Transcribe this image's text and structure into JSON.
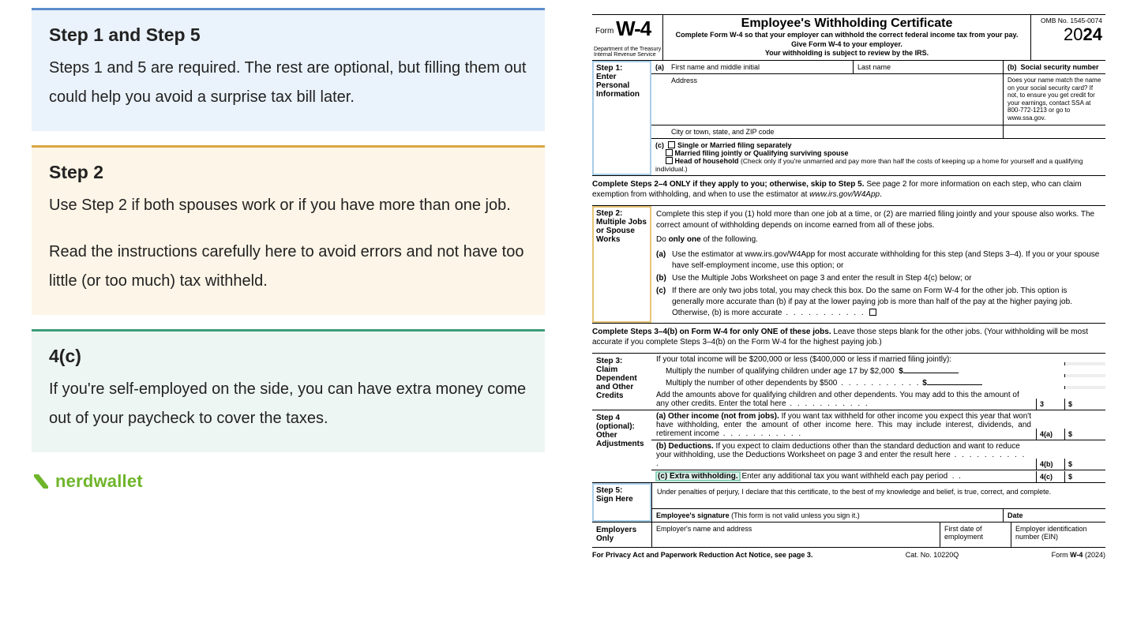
{
  "left": {
    "card1": {
      "title": "Step 1 and Step 5",
      "body": "Steps 1 and 5 are required. The rest are optional, but filling them out could help you avoid a surprise tax bill later."
    },
    "card2": {
      "title": "Step 2",
      "body1": "Use Step 2 if both spouses work or if you have more than one job.",
      "body2": "Read the instructions carefully here to avoid errors and not have too little (or too much) tax withheld."
    },
    "card3": {
      "title": "4(c)",
      "body": "If you're self-employed on the side, you can have extra money come out of your paycheck to cover the taxes."
    },
    "brand": "nerdwallet"
  },
  "form": {
    "form_word": "Form",
    "form_code": "W-4",
    "dept1": "Department of the Treasury",
    "dept2": "Internal Revenue Service",
    "title": "Employee's Withholding Certificate",
    "sub1": "Complete Form W-4 so that your employer can withhold the correct federal income tax from your pay.",
    "sub2": "Give Form W-4 to your employer.",
    "sub3": "Your withholding is subject to review by the IRS.",
    "omb": "OMB No. 1545-0074",
    "year_prefix": "20",
    "year_bold": "24",
    "step1": {
      "label": "Step 1:",
      "label2": "Enter Personal Information",
      "a_label": "(a)",
      "first": "First name and middle initial",
      "last": "Last name",
      "b_label": "(b)",
      "ssn": "Social security number",
      "address": "Address",
      "city": "City or town, state, and ZIP code",
      "match": "Does your name match the name on your social security card? If not, to ensure you get credit for your earnings, contact SSA at 800-772-1213 or go to www.ssa.gov.",
      "c_label": "(c)",
      "fs1": "Single or Married filing separately",
      "fs2": "Married filing jointly or Qualifying surviving spouse",
      "fs3": "Head of household (Check only if you're unmarried and pay more than half the costs of keeping up a home for yourself and a qualifying individual.)"
    },
    "note24": "Complete Steps 2–4 ONLY if they apply to you; otherwise, skip to Step 5. See page 2 for more information on each step, who can claim exemption from withholding, and when to use the estimator at www.irs.gov/W4App.",
    "step2": {
      "label": "Step 2:",
      "label2": "Multiple Jobs or Spouse Works",
      "intro": "Complete this step if you (1) hold more than one job at a time, or (2) are married filing jointly and your spouse also works. The correct amount of withholding depends on income earned from all of these jobs.",
      "only": "Do only one of the following.",
      "a": "Use the estimator at www.irs.gov/W4App for most accurate withholding for this step (and Steps 3–4). If you or your spouse have self-employment income, use this option; or",
      "b": "Use the Multiple Jobs Worksheet on page 3 and enter the result in Step 4(c) below; or",
      "c": "If there are only two jobs total, you may check this box. Do the same on Form W-4 for the other job. This option is generally more accurate than (b) if pay at the lower paying job is more than half of the pay at the higher paying job. Otherwise, (b) is more accurate"
    },
    "note34": "Complete Steps 3–4(b) on Form W-4 for only ONE of these jobs. Leave those steps blank for the other jobs. (Your withholding will be most accurate if you complete Steps 3–4(b) on the Form W-4 for the highest paying job.)",
    "step3": {
      "label": "Step 3:",
      "label2": "Claim Dependent and Other Credits",
      "intro": "If your total income will be $200,000 or less ($400,000 or less if married filing jointly):",
      "l1": "Multiply the number of qualifying children under age 17 by $2,000",
      "l2": "Multiply the number of other dependents by $500",
      "l3": "Add the amounts above for qualifying children and other dependents. You may add to this the amount of any other credits. Enter the total here",
      "n3": "3"
    },
    "step4": {
      "label": "Step 4 (optional):",
      "label2": "Other Adjustments",
      "a_b": "(a) Other income (not from jobs).",
      "a_t": " If you want tax withheld for other income you expect this year that won't have withholding, enter the amount of other income here. This may include interest, dividends, and retirement income",
      "na": "4(a)",
      "b_b": "(b) Deductions.",
      "b_t": " If you expect to claim deductions other than the standard deduction and want to reduce your withholding, use the Deductions Worksheet on page 3 and enter the result here",
      "nb": "4(b)",
      "c_b": "(c) Extra withholding.",
      "c_t": " Enter any additional tax you want withheld each pay period",
      "nc": "4(c)"
    },
    "step5": {
      "label": "Step 5:",
      "label2": "Sign Here",
      "decl": "Under penalties of perjury, I declare that this certificate, to the best of my knowledge and belief, is true, correct, and complete.",
      "sig": "Employee's signature (This form is not valid unless you sign it.)",
      "date": "Date"
    },
    "emp": {
      "label": "Employers Only",
      "name": "Employer's name and address",
      "first": "First date of employment",
      "ein": "Employer identification number (EIN)"
    },
    "foot_l": "For Privacy Act and Paperwork Reduction Act Notice, see page 3.",
    "foot_c": "Cat. No. 10220Q",
    "foot_r1": "Form ",
    "foot_r2": "W-4",
    "foot_r3": " (2024)",
    "dollar": "$"
  }
}
